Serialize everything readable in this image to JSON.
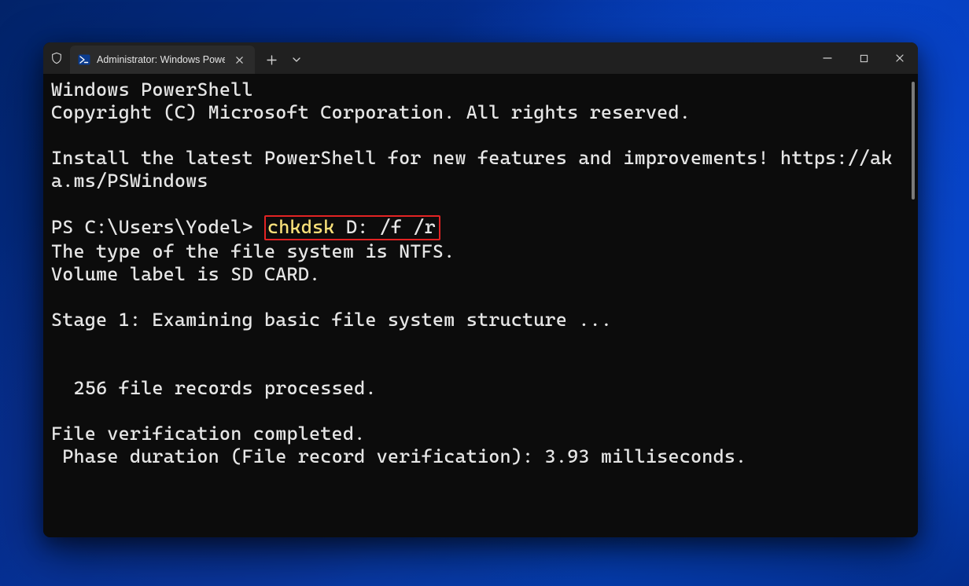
{
  "window": {
    "tab_title": "Administrator: Windows Powe",
    "icons": {
      "shield": "shield-icon",
      "powershell": "powershell-icon",
      "tab_close": "close-icon",
      "new_tab": "plus-icon",
      "tab_menu": "chevron-down-icon",
      "minimize": "minimize-icon",
      "maximize": "maximize-icon",
      "window_close": "close-icon"
    }
  },
  "terminal": {
    "banner_line1": "Windows PowerShell",
    "banner_line2": "Copyright (C) Microsoft Corporation. All rights reserved.",
    "install_hint": "Install the latest PowerShell for new features and improvements! https://aka.ms/PSWindows",
    "prompt": "PS C:\\Users\\Yodel> ",
    "command_name": "chkdsk",
    "command_args": " D: /f /r",
    "out_fs_type": "The type of the file system is NTFS.",
    "out_vol_label": "Volume label is SD CARD.",
    "out_stage1": "Stage 1: Examining basic file system structure ...",
    "out_records": "  256 file records processed.",
    "out_verify_done": "File verification completed.",
    "out_phase_duration": " Phase duration (File record verification): 3.93 milliseconds."
  }
}
